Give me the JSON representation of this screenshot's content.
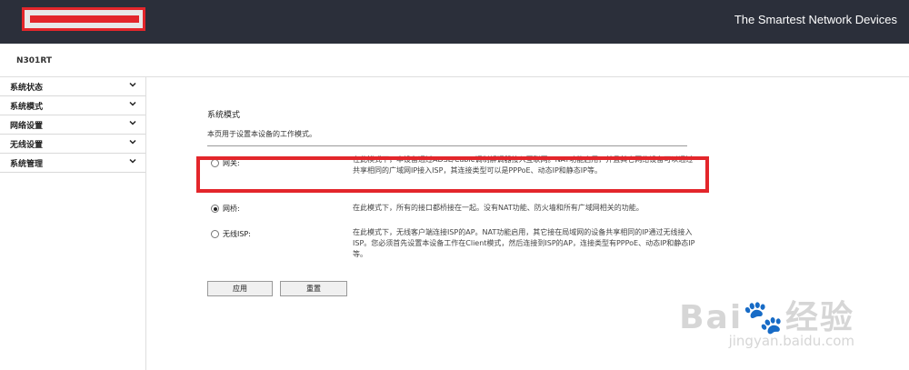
{
  "header": {
    "tagline": "The Smartest Network Devices",
    "logo_icon": "brand-logo-icon"
  },
  "model": "N301RT",
  "sidebar": {
    "items": [
      {
        "label": "系统状态",
        "icon": "chevron-down-icon"
      },
      {
        "label": "系统模式",
        "icon": "chevron-down-icon"
      },
      {
        "label": "网络设置",
        "icon": "chevron-down-icon"
      },
      {
        "label": "无线设置",
        "icon": "chevron-down-icon"
      },
      {
        "label": "系统管理",
        "icon": "chevron-down-icon"
      }
    ]
  },
  "main": {
    "title": "系统模式",
    "description": "本页用于设置本设备的工作模式。",
    "options": [
      {
        "label": "网关:",
        "selected": false,
        "description": "在此模式下，本设备通过ADSL/Cable调制解调器接入互联网。NAT功能启用，并且其它网络设备可以通过共享相同的广域网IP接入ISP，其连接类型可以是PPPoE、动态IP和静态IP等。"
      },
      {
        "label": "网桥:",
        "selected": true,
        "description": "在此模式下，所有的接口都桥接在一起。没有NAT功能、防火墙和所有广域网相关的功能。"
      },
      {
        "label": "无线ISP:",
        "selected": false,
        "description": "在此模式下，无线客户端连接ISP的AP。NAT功能启用，其它接在局域网的设备共享相同的IP通过无线接入ISP。您必须首先设置本设备工作在Client模式，然后连接到ISP的AP，连接类型有PPPoE、动态IP和静态IP等。"
      }
    ],
    "apply_label": "应用",
    "reset_label": "重置"
  },
  "watermark": {
    "line1": "Bai🐾经验",
    "line2": "jingyan.baidu.com"
  },
  "colors": {
    "header_bg": "#2b2f3a",
    "highlight": "#e3262b"
  }
}
